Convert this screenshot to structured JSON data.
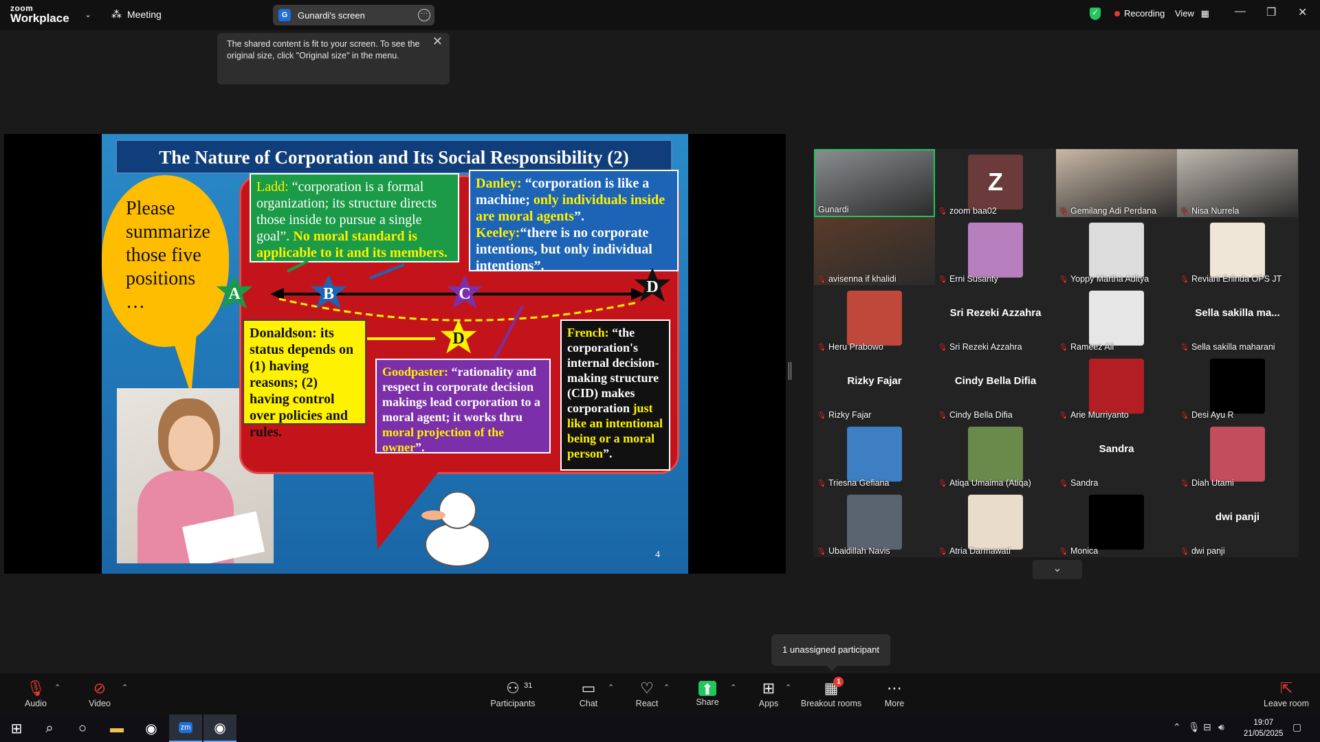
{
  "app": {
    "logo_line1": "zoom",
    "logo_line2": "Workplace",
    "meeting_label": "Meeting",
    "shared_screen_label": "Gunardi's screen",
    "shared_screen_initial": "G",
    "recording_label": "Recording",
    "view_label": "View"
  },
  "tooltip": {
    "text": "The shared content is fit to your screen. To see the original size, click \"Original size\" in the menu."
  },
  "slide": {
    "title": "The Nature of Corporation and Its Social Responsibility (2)",
    "prompt": "Please summarize those five positions …",
    "ladd_name": "Ladd:",
    "ladd_text": " “corporation is a formal organization; its structure directs those inside to pursue a single goal”.",
    "ladd_hl": " No moral standard is applicable to it and its members.",
    "danley_name": "Danley:",
    "danley_text": " “corporation is like a machine;",
    "danley_hl": " only individuals inside are moral agents",
    "danley_end": "”.",
    "keeley_name": "Keeley:",
    "keeley_text": "“there is no corporate intentions, but only individual intentions”.",
    "donaldson_text": "Donaldson: its status depends on (1) having reasons; (2) having control over policies and rules.",
    "goodpaster_name": "Goodpaster:",
    "goodpaster_text": " “rationality and respect in corporate decision makings lead corporation to a moral agent; it works thru",
    "goodpaster_hl": " moral projection of the owner",
    "goodpaster_end": "”.",
    "french_name": "French:",
    "french_text": " “the corporation's internal decision-making structure (CID) makes corporation",
    "french_hl": " just like an intentional being or a moral person",
    "french_end": "”.",
    "star_a": "A",
    "star_b": "B",
    "star_c": "C",
    "star_d1": "D",
    "star_d2": "D",
    "page_number": "4"
  },
  "participants": [
    {
      "name": "Gunardi",
      "type": "video",
      "color": "#8a8d90",
      "active": true,
      "muted": false
    },
    {
      "name": "zoom baa02",
      "type": "initial",
      "initial": "Z",
      "muted": true
    },
    {
      "name": "Gemilang Adi Perdana",
      "type": "video",
      "color": "#c9b8a6",
      "muted": true
    },
    {
      "name": "Nisa Nurrela",
      "type": "video",
      "color": "#bfbab0",
      "muted": true
    },
    {
      "name": "avisenna if khalidi",
      "type": "video",
      "color": "#5a3b2a",
      "muted": true
    },
    {
      "name": "Erni Susanty",
      "type": "avatar",
      "color": "#b87fbe",
      "muted": true
    },
    {
      "name": "Yoppy Martha Aditya",
      "type": "avatar",
      "color": "#dcdcdc",
      "muted": true
    },
    {
      "name": "Reviani Erlinda OPS JT",
      "type": "avatar",
      "color": "#f0e6d8",
      "muted": true
    },
    {
      "name": "Heru Prabowo",
      "type": "avatar",
      "color": "#c0483b",
      "muted": true
    },
    {
      "name": "Sri Rezeki Azzahra",
      "type": "name",
      "display": "Sri Rezeki Azzahra",
      "muted": true
    },
    {
      "name": "Rameez Ali",
      "type": "avatar",
      "color": "#e6e6e6",
      "muted": true
    },
    {
      "name": "Sella sakilla maharani",
      "type": "name",
      "display": "Sella sakilla ma...",
      "muted": true
    },
    {
      "name": "Rizky Fajar",
      "type": "name",
      "display": "Rizky Fajar",
      "muted": true
    },
    {
      "name": "Cindy Bella Difia",
      "type": "name",
      "display": "Cindy Bella Difia",
      "muted": true
    },
    {
      "name": "Arie Murriyanto",
      "type": "avatar",
      "color": "#b21e24",
      "muted": true
    },
    {
      "name": "Desi Ayu R",
      "type": "avatar",
      "color": "#000000",
      "muted": true
    },
    {
      "name": "Triesna Gefiana",
      "type": "avatar",
      "color": "#3d7fc2",
      "muted": true
    },
    {
      "name": "Atiqa Umaima (Atiqa)",
      "type": "avatar",
      "color": "#6a8a4c",
      "muted": true
    },
    {
      "name": "Sandra",
      "type": "name",
      "display": "Sandra",
      "muted": true
    },
    {
      "name": "Diah Utami",
      "type": "avatar",
      "color": "#c24d5c",
      "muted": true
    },
    {
      "name": "Ubaidillah Navis",
      "type": "avatar",
      "color": "#5a6470",
      "muted": true
    },
    {
      "name": "Atria Darmawati",
      "type": "avatar",
      "color": "#e8dccb",
      "muted": true
    },
    {
      "name": "Monica",
      "type": "avatar",
      "color": "#000000",
      "muted": true
    },
    {
      "name": "dwi panji",
      "type": "name",
      "display": "dwi panji",
      "muted": true
    }
  ],
  "unassigned_label": "1 unassigned participant",
  "toolbar": {
    "audio": "Audio",
    "video": "Video",
    "participants": "Participants",
    "participants_count": "31",
    "chat": "Chat",
    "react": "React",
    "share": "Share",
    "apps": "Apps",
    "breakout": "Breakout rooms",
    "breakout_badge": "1",
    "more": "More",
    "leave": "Leave room"
  },
  "taskbar": {
    "time": "19:07",
    "date": "21/05/2025"
  }
}
